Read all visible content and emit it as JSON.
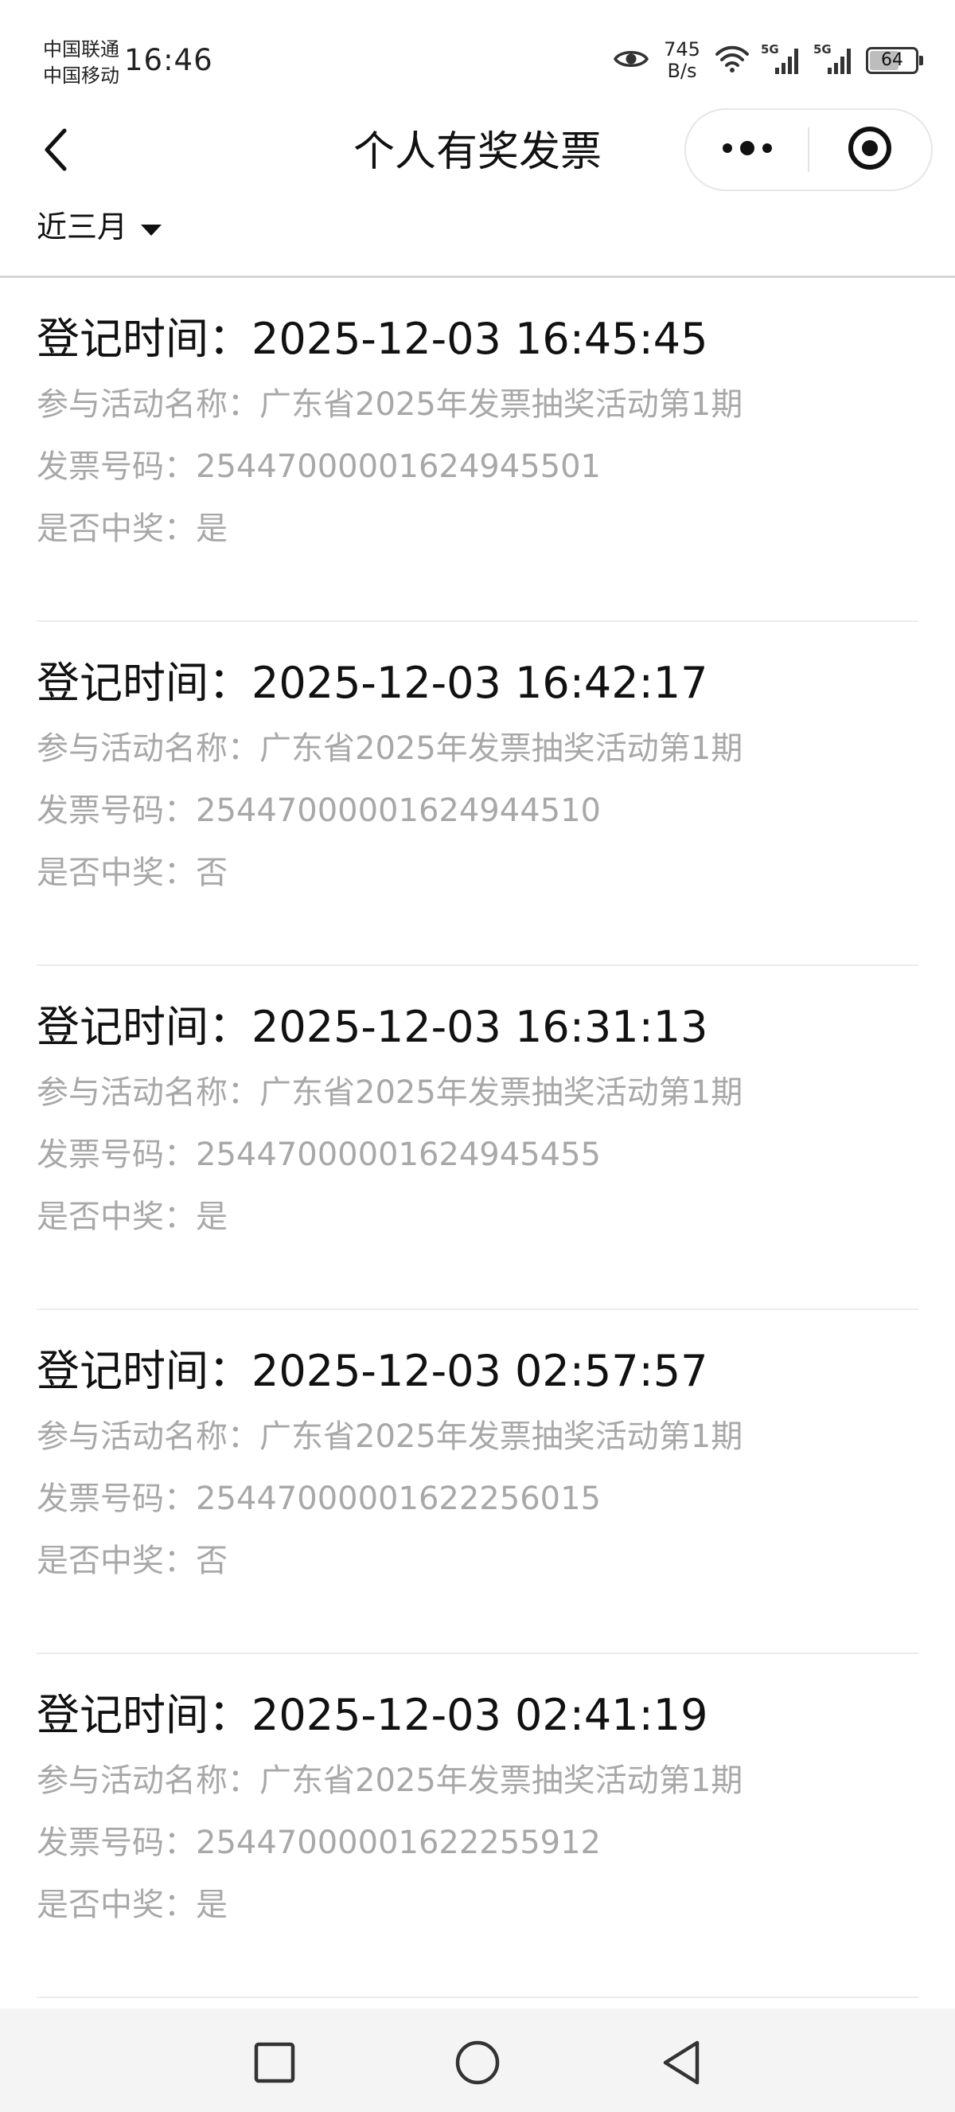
{
  "status_bar": {
    "carrier_1": "中国联通",
    "carrier_2": "中国移动",
    "time": "16:46",
    "net_speed_value": "745",
    "net_speed_unit": "B/s",
    "signal_label_1": "5G",
    "signal_label_2": "5G",
    "battery_level": "64",
    "icons": [
      "eye-icon",
      "wifi-icon",
      "signal-icon",
      "battery-icon"
    ]
  },
  "nav": {
    "title": "个人有奖发票",
    "back_icon": "chevron-left-icon",
    "more_icon": "more-dots-icon",
    "close_icon": "target-close-icon"
  },
  "filter": {
    "label": "近三月",
    "icon": "caret-down-icon"
  },
  "records": [
    {
      "time_label": "登记时间：",
      "time": "2025-12-03 16:45:45",
      "activity_label": "参与活动名称：",
      "activity": "广东省2025年发票抽奖活动第1期",
      "invoice_label": "发票号码：",
      "invoice": "25447000001624945501",
      "win_label": "是否中奖：",
      "win": "是"
    },
    {
      "time_label": "登记时间：",
      "time": "2025-12-03 16:42:17",
      "activity_label": "参与活动名称：",
      "activity": "广东省2025年发票抽奖活动第1期",
      "invoice_label": "发票号码：",
      "invoice": "25447000001624944510",
      "win_label": "是否中奖：",
      "win": "否"
    },
    {
      "time_label": "登记时间：",
      "time": "2025-12-03 16:31:13",
      "activity_label": "参与活动名称：",
      "activity": "广东省2025年发票抽奖活动第1期",
      "invoice_label": "发票号码：",
      "invoice": "25447000001624945455",
      "win_label": "是否中奖：",
      "win": "是"
    },
    {
      "time_label": "登记时间：",
      "time": "2025-12-03 02:57:57",
      "activity_label": "参与活动名称：",
      "activity": "广东省2025年发票抽奖活动第1期",
      "invoice_label": "发票号码：",
      "invoice": "25447000001622256015",
      "win_label": "是否中奖：",
      "win": "否"
    },
    {
      "time_label": "登记时间：",
      "time": "2025-12-03 02:41:19",
      "activity_label": "参与活动名称：",
      "activity": "广东省2025年发票抽奖活动第1期",
      "invoice_label": "发票号码：",
      "invoice": "25447000001622255912",
      "win_label": "是否中奖：",
      "win": "是"
    }
  ],
  "system_nav": {
    "recent_icon": "square-icon",
    "home_icon": "circle-icon",
    "back_icon": "triangle-back-icon"
  },
  "colors": {
    "title_text": "#111111",
    "secondary_text": "#a8a8a8",
    "divider": "#ececec",
    "system_nav_bg": "#f4f4f4"
  }
}
